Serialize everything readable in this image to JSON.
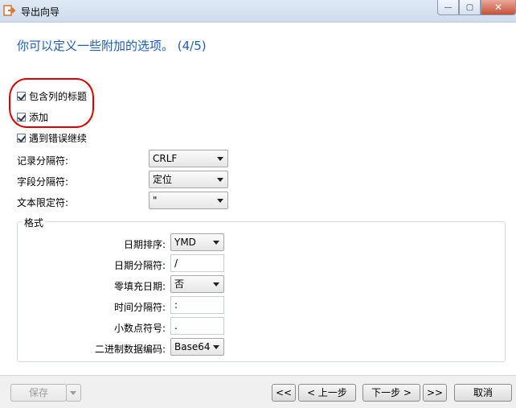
{
  "window": {
    "title": "导出向导",
    "close_label": "✕",
    "min_label": "—",
    "max_label": "▢"
  },
  "heading": "你可以定义一些附加的选项。 (4/5)",
  "options": {
    "include_headers": "包含列的标题",
    "append": "添加",
    "continue_on_error": "遇到错误继续"
  },
  "fields": {
    "record_sep": {
      "label": "记录分隔符:",
      "value": "CRLF"
    },
    "field_sep": {
      "label": "字段分隔符:",
      "value": "定位"
    },
    "text_qualifier": {
      "label": "文本限定符:",
      "value": "\""
    }
  },
  "format": {
    "title": "格式",
    "date_order": {
      "label": "日期排序:",
      "value": "YMD"
    },
    "date_sep": {
      "label": "日期分隔符:",
      "value": "/"
    },
    "zero_pad_date": {
      "label": "零填充日期:",
      "value": "否"
    },
    "time_sep": {
      "label": "时间分隔符:",
      "value": ":"
    },
    "decimal_symbol": {
      "label": "小数点符号:",
      "value": "."
    },
    "binary_encoding": {
      "label": "二进制数据编码:",
      "value": "Base64"
    }
  },
  "buttons": {
    "save": "保存",
    "first": "<<",
    "prev": "< 上一步",
    "next": "下一步 >",
    "last": ">>",
    "cancel": "取消"
  }
}
